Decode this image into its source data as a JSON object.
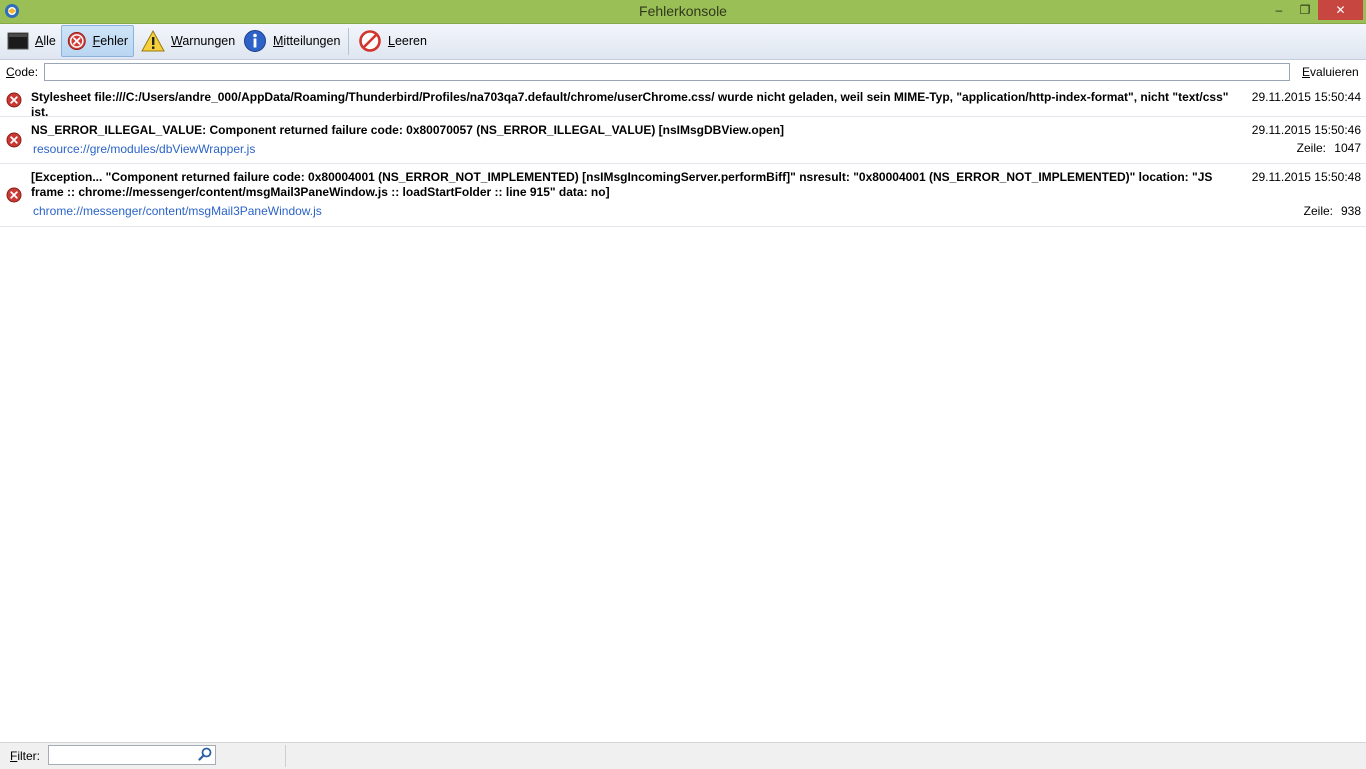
{
  "window": {
    "title": "Fehlerkonsole",
    "controls": {
      "minimize": "–",
      "maximize": "❐",
      "close": "✕"
    }
  },
  "toolbar": {
    "all_label": "Alle",
    "errors_label": "Fehler",
    "warnings_label": "Warnungen",
    "messages_label": "Mitteilungen",
    "clear_label": "Leeren",
    "active_filter": "Fehler"
  },
  "code": {
    "label": "Code:",
    "value": "",
    "evaluate_label": "Evaluieren"
  },
  "messages": [
    {
      "type": "error",
      "text": "Stylesheet file:///C:/Users/andre_000/AppData/Roaming/Thunderbird/Profiles/na703qa7.default/chrome/userChrome.css/ wurde nicht geladen, weil sein MIME-Typ, \"application/http-index-format\", nicht \"text/css\" ist.",
      "time": "29.11.2015 15:50:44"
    },
    {
      "type": "error",
      "text": "NS_ERROR_ILLEGAL_VALUE: Component returned failure code: 0x80070057 (NS_ERROR_ILLEGAL_VALUE) [nsIMsgDBView.open]",
      "source": "resource://gre/modules/dbViewWrapper.js",
      "time": "29.11.2015 15:50:46",
      "line_label": "Zeile:",
      "line": "1047"
    },
    {
      "type": "error",
      "text": "[Exception... \"Component returned failure code: 0x80004001 (NS_ERROR_NOT_IMPLEMENTED) [nsIMsgIncomingServer.performBiff]\"  nsresult: \"0x80004001 (NS_ERROR_NOT_IMPLEMENTED)\"  location: \"JS frame :: chrome://messenger/content/msgMail3PaneWindow.js :: loadStartFolder :: line 915\"  data: no]",
      "source": "chrome://messenger/content/msgMail3PaneWindow.js",
      "time": "29.11.2015 15:50:48",
      "line_label": "Zeile:",
      "line": "938"
    }
  ],
  "filter": {
    "label": "Filter:",
    "value": ""
  },
  "colors": {
    "titlebar": "#9bbf57",
    "close_button": "#c7463f",
    "link": "#2a63c8",
    "error_icon": "#c0392b"
  },
  "icons": {
    "app": "thunderbird-icon",
    "all": "console-icon",
    "errors": "error-icon",
    "warnings": "warning-icon",
    "messages": "info-icon",
    "clear": "clear-icon",
    "search": "search-icon"
  }
}
